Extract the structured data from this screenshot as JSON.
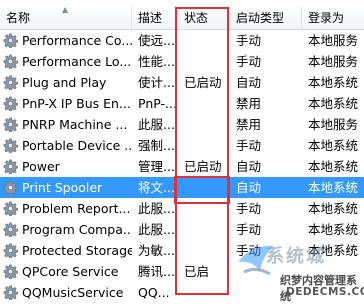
{
  "columns": [
    "名称",
    "描述",
    "状态",
    "启动类型",
    "登录为"
  ],
  "rows": [
    {
      "name": "Performance Co...",
      "desc": "使远...",
      "status": "",
      "startup": "手动",
      "logon": "本地服务",
      "selected": false
    },
    {
      "name": "Performance Lo...",
      "desc": "性能...",
      "status": "",
      "startup": "手动",
      "logon": "本地服务",
      "selected": false
    },
    {
      "name": "Plug and Play",
      "desc": "使计...",
      "status": "已启动",
      "startup": "自动",
      "logon": "本地系统",
      "selected": false
    },
    {
      "name": "PnP-X IP Bus En...",
      "desc": "PnP-...",
      "status": "",
      "startup": "禁用",
      "logon": "本地系统",
      "selected": false
    },
    {
      "name": "PNRP Machine ...",
      "desc": "此服...",
      "status": "",
      "startup": "禁用",
      "logon": "本地服务",
      "selected": false
    },
    {
      "name": "Portable Device ...",
      "desc": "强制...",
      "status": "",
      "startup": "手动",
      "logon": "本地系统",
      "selected": false
    },
    {
      "name": "Power",
      "desc": "管理...",
      "status": "已启动",
      "startup": "自动",
      "logon": "本地系统",
      "selected": false
    },
    {
      "name": "Print Spooler",
      "desc": "将文...",
      "status": "",
      "startup": "自动",
      "logon": "本地系统",
      "selected": true
    },
    {
      "name": "Problem Report...",
      "desc": "此服...",
      "status": "",
      "startup": "手动",
      "logon": "本地系统",
      "selected": false
    },
    {
      "name": "Program Compa...",
      "desc": "此服...",
      "status": "",
      "startup": "手动",
      "logon": "本地系统",
      "selected": false
    },
    {
      "name": "Protected Storage",
      "desc": "为敏...",
      "status": "",
      "startup": "手动",
      "logon": "本地系统",
      "selected": false
    },
    {
      "name": "QPCore Service",
      "desc": "腾讯...",
      "status": "已启",
      "startup": "",
      "logon": "",
      "selected": false
    },
    {
      "name": "QQMusicService",
      "desc": "QQ...",
      "status": "",
      "startup": "",
      "logon": "",
      "selected": false
    }
  ],
  "watermark": {
    "brand": "系统城",
    "line1": "织梦内容管理系统",
    "line2": "DEDECMS.COM"
  },
  "colors": {
    "highlight": "#e0313b",
    "selection": "#3399ff"
  }
}
